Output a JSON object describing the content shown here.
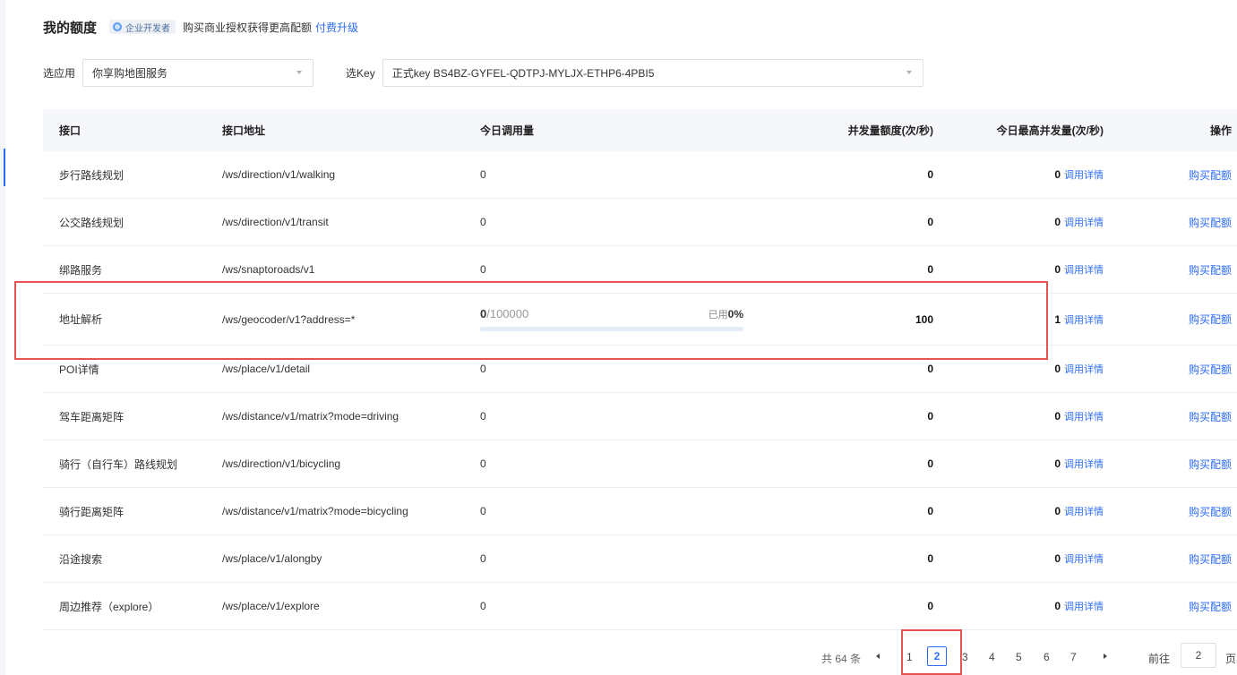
{
  "header": {
    "title": "我的额度",
    "badge": "企业开发者",
    "description": "购买商业授权获得更高配额",
    "upgrade_link": "付费升级"
  },
  "filters": {
    "app_label": "选应用",
    "app_value": "你享购地图服务",
    "key_label": "选Key",
    "key_value": "正式key BS4BZ-GYFEL-QDTPJ-MYLJX-ETHP6-4PBI5"
  },
  "table": {
    "columns": [
      "接口",
      "接口地址",
      "今日调用量",
      "并发量额度(次/秒)",
      "今日最高并发量(次/秒)",
      "操作"
    ],
    "detail_link": "调用详情",
    "buy_link": "购买配额",
    "rows": [
      {
        "name": "步行路线规划",
        "path": "/ws/direction/v1/walking",
        "calls": "0",
        "quota": "0",
        "peak": "0"
      },
      {
        "name": "公交路线规划",
        "path": "/ws/direction/v1/transit",
        "calls": "0",
        "quota": "0",
        "peak": "0"
      },
      {
        "name": "绑路服务",
        "path": "/ws/snaptoroads/v1",
        "calls": "0",
        "quota": "0",
        "peak": "0"
      },
      {
        "name": "地址解析",
        "path": "/ws/geocoder/v1?address=*",
        "calls": "",
        "quota": "100",
        "peak": "1",
        "usage": {
          "used": "0",
          "total": "/100000",
          "pct_label": "已用",
          "pct": "0%",
          "fraction": 0
        }
      },
      {
        "name": "POI详情",
        "path": "/ws/place/v1/detail",
        "calls": "0",
        "quota": "0",
        "peak": "0"
      },
      {
        "name": "驾车距离矩阵",
        "path": "/ws/distance/v1/matrix?mode=driving",
        "calls": "0",
        "quota": "0",
        "peak": "0"
      },
      {
        "name": "骑行（自行车）路线规划",
        "path": "/ws/direction/v1/bicycling",
        "calls": "0",
        "quota": "0",
        "peak": "0"
      },
      {
        "name": "骑行距离矩阵",
        "path": "/ws/distance/v1/matrix?mode=bicycling",
        "calls": "0",
        "quota": "0",
        "peak": "0"
      },
      {
        "name": "沿途搜索",
        "path": "/ws/place/v1/alongby",
        "calls": "0",
        "quota": "0",
        "peak": "0"
      },
      {
        "name": "周边推荐（explore）",
        "path": "/ws/place/v1/explore",
        "calls": "0",
        "quota": "0",
        "peak": "0"
      }
    ]
  },
  "pagination": {
    "total_label": "共 64 条",
    "pages": [
      "1",
      "2",
      "3",
      "4",
      "5",
      "6",
      "7"
    ],
    "current": "2",
    "goto_label": "前往",
    "goto_value": "2",
    "goto_suffix": "页"
  }
}
